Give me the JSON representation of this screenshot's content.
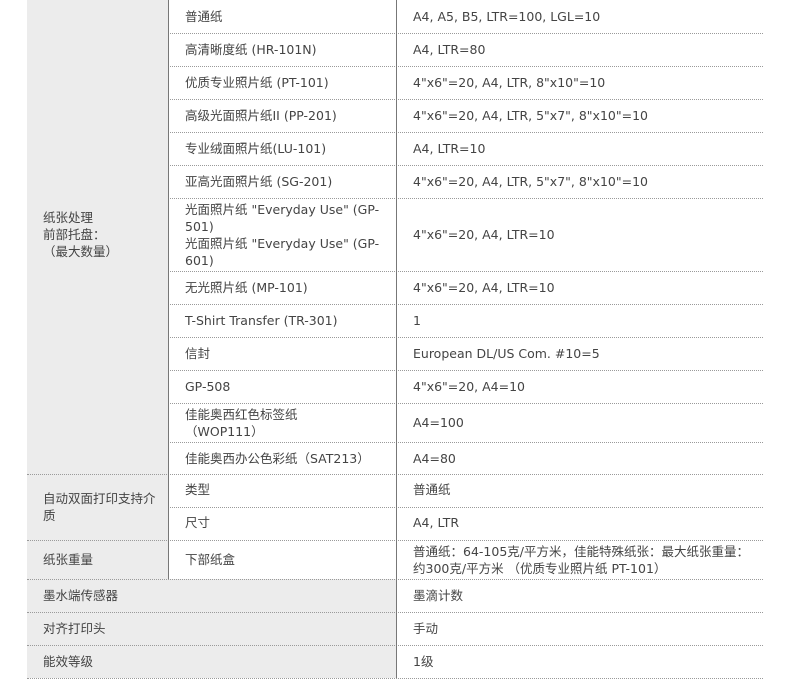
{
  "spec_table": {
    "paper_handling": {
      "category_label": "纸张处理\n前部托盘：\n（最大数量）",
      "rows": [
        {
          "paper": "普通纸",
          "capacity": "A4, A5, B5, LTR=100, LGL=10"
        },
        {
          "paper": "高清晰度纸 (HR-101N)",
          "capacity": "A4, LTR=80"
        },
        {
          "paper": "优质专业照片纸 (PT-101)",
          "capacity": "4\"x6\"=20, A4, LTR, 8\"x10\"=10"
        },
        {
          "paper": "高级光面照片纸II (PP-201)",
          "capacity": "4\"x6\"=20, A4, LTR, 5\"x7\", 8\"x10\"=10"
        },
        {
          "paper": "专业绒面照片纸(LU-101)",
          "capacity": "A4, LTR=10"
        },
        {
          "paper": "亚高光面照片纸 (SG-201)",
          "capacity": "4\"x6\"=20, A4, LTR, 5\"x7\", 8\"x10\"=10"
        },
        {
          "paper": "光面照片纸 \"Everyday Use\" (GP-\n501)\n光面照片纸 \"Everyday Use\" (GP-\n601)",
          "capacity": "4\"x6\"=20, A4, LTR=10"
        },
        {
          "paper": "无光照片纸 (MP-101)",
          "capacity": "4\"x6\"=20, A4, LTR=10"
        },
        {
          "paper": "T-Shirt Transfer (TR-301)",
          "capacity": "1"
        },
        {
          "paper": "信封",
          "capacity": "European DL/US Com. #10=5"
        },
        {
          "paper": "GP-508",
          "capacity": "4\"x6\"=20, A4=10"
        },
        {
          "paper": "佳能奥西红色标签纸\n（WOP111）",
          "capacity": "A4=100"
        },
        {
          "paper": "佳能奥西办公色彩纸（SAT213）",
          "capacity": "A4=80"
        }
      ]
    },
    "duplex": {
      "category_label": "自动双面打印支持介\n质",
      "rows": [
        {
          "label": "类型",
          "value": "普通纸"
        },
        {
          "label": "尺寸",
          "value": "A4, LTR"
        }
      ]
    },
    "paper_weight": {
      "category_label": "纸张重量",
      "label": "下部纸盒",
      "value": "普通纸：64-105克/平方米，佳能特殊纸张：最大纸张重量：\n约300克/平方米 （优质专业照片纸 PT-101）"
    },
    "simple_rows": [
      {
        "label": "墨水端传感器",
        "value": "墨滴计数"
      },
      {
        "label": "对齐打印头",
        "value": "手动"
      },
      {
        "label": "能效等级",
        "value": "1级"
      }
    ]
  }
}
